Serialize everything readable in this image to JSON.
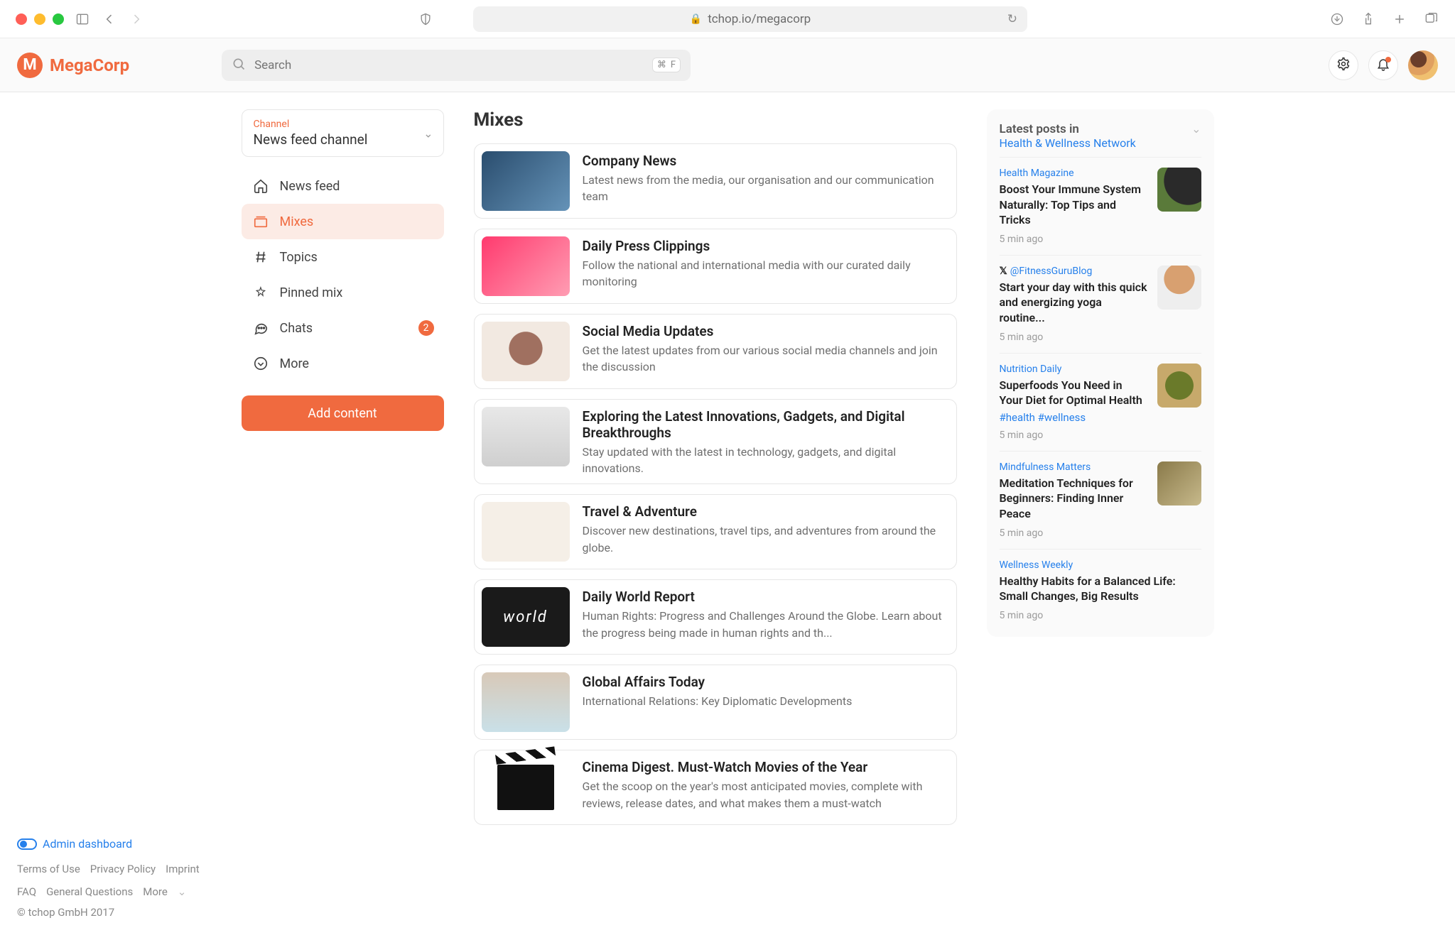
{
  "browser": {
    "url": "tchop.io/megacorp"
  },
  "brand": {
    "name": "MegaCorp",
    "initial": "M"
  },
  "search": {
    "placeholder": "Search",
    "shortcut_cmd": "⌘",
    "shortcut_key": "F"
  },
  "sidebar": {
    "channel_label": "Channel",
    "channel_value": "News feed channel",
    "items": [
      {
        "label": "News feed"
      },
      {
        "label": "Mixes"
      },
      {
        "label": "Topics"
      },
      {
        "label": "Pinned mix"
      },
      {
        "label": "Chats",
        "badge": "2"
      },
      {
        "label": "More"
      }
    ],
    "add_button": "Add content",
    "admin_link": "Admin dashboard",
    "footer_links": [
      "Terms of Use",
      "Privacy Policy",
      "Imprint",
      "FAQ",
      "General Questions",
      "More"
    ],
    "copyright": "© tchop GmbH 2017"
  },
  "main": {
    "heading": "Mixes",
    "mixes": [
      {
        "title": "Company News",
        "desc": "Latest news from the media, our organisation and our communication team"
      },
      {
        "title": "Daily Press Clippings",
        "desc": "Follow the national and international media with our curated daily monitoring"
      },
      {
        "title": "Social Media Updates",
        "desc": "Get the latest updates from our various social media channels and join the discussion"
      },
      {
        "title": "Exploring the Latest Innovations, Gadgets, and Digital Breakthroughs",
        "desc": "Stay updated with the latest in technology, gadgets, and digital innovations."
      },
      {
        "title": "Travel & Adventure",
        "desc": "Discover new destinations, travel tips, and adventures from around the globe."
      },
      {
        "title": "Daily World Report",
        "desc": "Human Rights: Progress and Challenges Around the Globe. Learn about the progress being made in human rights and th..."
      },
      {
        "title": "Global Affairs Today",
        "desc": "International Relations: Key Diplomatic Developments"
      },
      {
        "title": "Cinema Digest. Must-Watch Movies of the Year",
        "desc": "Get the scoop on the year's most anticipated movies, complete with reviews, release dates, and what makes them a must-watch"
      }
    ],
    "world_label": "world"
  },
  "right": {
    "heading": "Latest posts in",
    "sub": "Health & Wellness Network",
    "posts": [
      {
        "src": "Health Magazine",
        "title": "Boost Your Immune System Naturally: Top Tips and Tricks",
        "time": "5 min ago",
        "img": "pimg-health"
      },
      {
        "src": "@FitnessGuruBlog",
        "src_icon": "x",
        "title": "Start your day with this quick and energizing yoga routine...",
        "time": "5 min ago",
        "img": "pimg-yoga"
      },
      {
        "src": "Nutrition Daily",
        "title": "Superfoods You Need in Your Diet for Optimal Health",
        "tags": "#health #wellness",
        "time": "5 min ago",
        "img": "pimg-food"
      },
      {
        "src": "Mindfulness Matters",
        "title": "Meditation Techniques for Beginners: Finding Inner Peace",
        "time": "5 min ago",
        "img": "pimg-mind"
      },
      {
        "src": "Wellness Weekly",
        "title": "Healthy Habits for a Balanced Life: Small Changes, Big Results",
        "time": "5 min ago"
      }
    ]
  }
}
